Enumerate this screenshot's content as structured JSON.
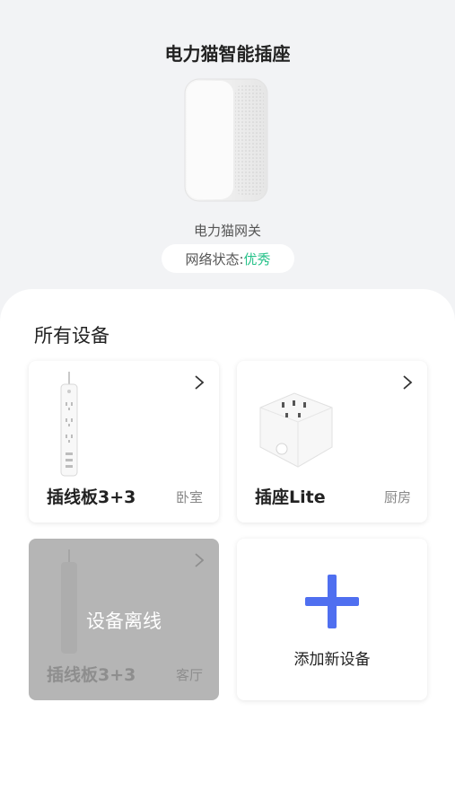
{
  "header": {
    "title": "电力猫智能插座",
    "gateway_name": "电力猫网关",
    "network_label": "网络状态:",
    "network_value": "优秀"
  },
  "devices_section": {
    "title": "所有设备",
    "cards": [
      {
        "name": "插线板3+3",
        "room": "卧室",
        "online": true
      },
      {
        "name": "插座Lite",
        "room": "厨房",
        "online": true
      },
      {
        "name": "插线板3+3",
        "room": "客厅",
        "online": false,
        "status_text": "设备离线"
      }
    ],
    "add_label": "添加新设备"
  },
  "colors": {
    "accent_blue": "#4f6ff0",
    "status_green": "#27c28a",
    "offline_gray": "#b5b5b5"
  },
  "icons": [
    "chevron-right-icon",
    "plus-icon"
  ]
}
